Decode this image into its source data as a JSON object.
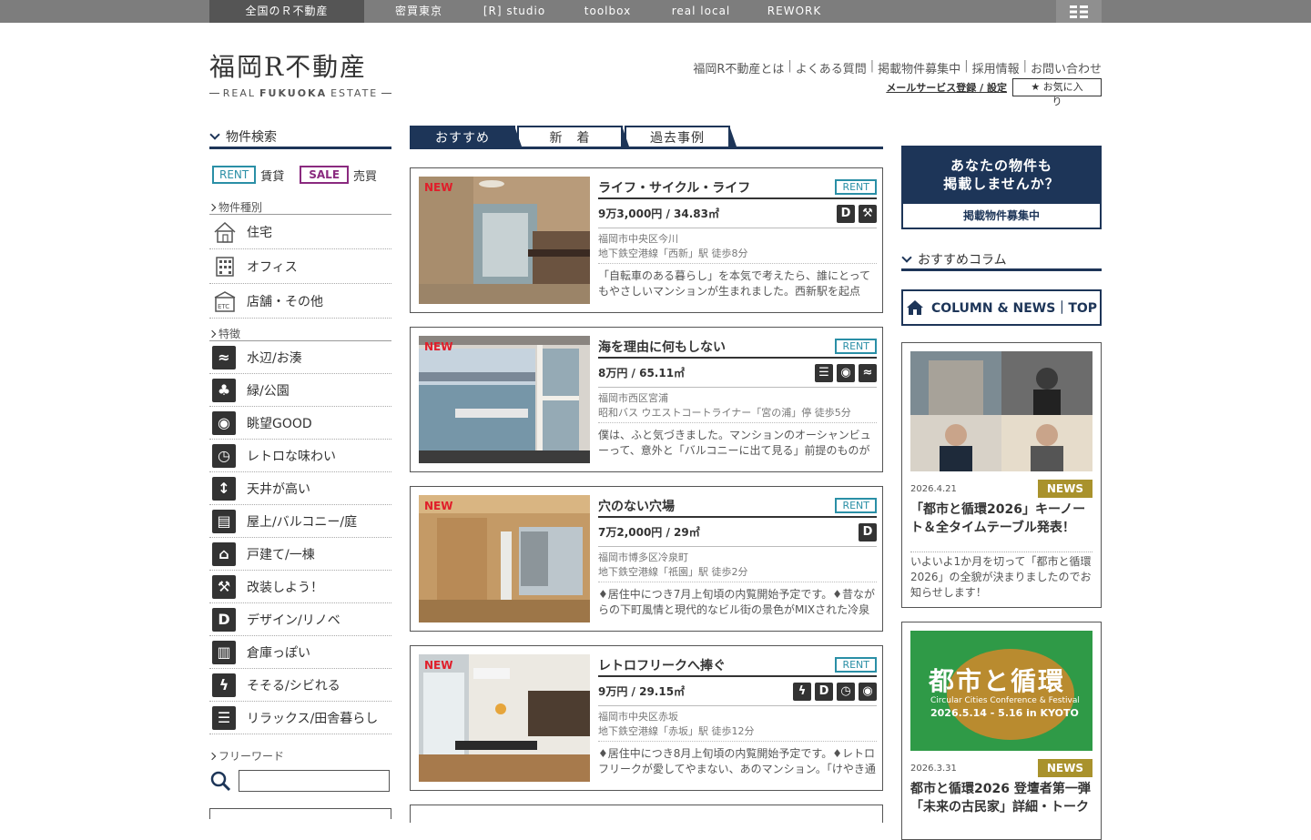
{
  "topnav": {
    "items": [
      "全国のＲ不動産",
      "密買東京",
      "[R] studio",
      "toolbox",
      "real local",
      "REWORK"
    ]
  },
  "header": {
    "logo_jp": "福岡R不動産",
    "logo_en_a": "REAL",
    "logo_en_b": "FUKUOKA",
    "logo_en_c": "ESTATE",
    "links": [
      "福岡R不動産とは",
      "よくある質問",
      "掲載物件募集中",
      "採用情報",
      "お問い合わせ"
    ],
    "mail_service": "メールサービス登録 / 設定",
    "favorites": "★ お気に入り"
  },
  "sidebar": {
    "search_title": "物件検索",
    "rent_badge": "RENT",
    "rent_label": "賃貸",
    "sale_badge": "SALE",
    "sale_label": "売買",
    "type_heading": "物件種別",
    "types": [
      "住宅",
      "オフィス",
      "店舗・その他"
    ],
    "feature_heading": "特徴",
    "features": [
      "水辺/お湊",
      "緑/公園",
      "眺望GOOD",
      "レトロな味わい",
      "天井が高い",
      "屋上/バルコニー/庭",
      "戸建て/一棟",
      "改装しよう！",
      "デザイン/リノベ",
      "倉庫っぽい",
      "そそる/シビれる",
      "リラックス/田舎暮らし"
    ],
    "keyword_heading": "フリーワード",
    "keyword_value": ""
  },
  "tabs": [
    "おすすめ",
    "新　着",
    "過去事例"
  ],
  "listings": [
    {
      "new": "NEW",
      "title": "ライフ・サイクル・ライフ",
      "badge": "RENT",
      "price": "9万3,000円 / 34.83㎡",
      "icons": [
        "D",
        "tool"
      ],
      "addr1": "福岡市中央区今川",
      "addr2": "地下鉄空港線「西新」駅 徒歩8分",
      "desc": "「自転車のある暮らし」を本気で考えたら、誰にとってもやさしいマンションが生まれました。西新駅を起点"
    },
    {
      "new": "NEW",
      "title": "海を理由に何もしない",
      "badge": "RENT",
      "price": "8万円 / 65.11㎡",
      "icons": [
        "wave",
        "eye",
        "shore"
      ],
      "addr1": "福岡市西区宮浦",
      "addr2": "昭和バス ウエストコートライナー「宮の浦」停 徒歩5分",
      "desc": "僕は、ふと気づきました。マンションのオーシャンビューって、意外と「バルコニーに出て見る」前提のものが"
    },
    {
      "new": "NEW",
      "title": "穴のない穴場",
      "badge": "RENT",
      "price": "7万2,000円 / 29㎡",
      "icons": [
        "D"
      ],
      "addr1": "福岡市博多区冷泉町",
      "addr2": "地下鉄空港線「祇園」駅 徒歩2分",
      "desc": "♦居住中につき7月上旬頃の内覧開始予定です。♦昔ながらの下町風情と現代的なビル街の景色がMIXされた冷泉"
    },
    {
      "new": "NEW",
      "title": "レトロフリークへ捧ぐ",
      "badge": "RENT",
      "price": "9万円 / 29.15㎡",
      "icons": [
        "bolt",
        "D",
        "retro",
        "eye"
      ],
      "addr1": "福岡市中央区赤坂",
      "addr2": "地下鉄空港線「赤坂」駅 徒歩12分",
      "desc": "♦居住中につき8月上旬頃の内覧開始予定です。♦レトロフリークが愛してやまない、あのマンション。「けやき通"
    }
  ],
  "right": {
    "promo_line1": "あなたの物件も",
    "promo_line2": "掲載しませんか？",
    "promo_button": "掲載物件募集中",
    "column_title": "おすすめコラム",
    "column_button": "COLUMN & NEWS｜TOP",
    "news": [
      {
        "date": "2026.4.21",
        "tag": "NEWS",
        "title": "「都市と循環2026」キーノート＆全タイムテーブル発表！",
        "body": "いよいよ1か月を切って「都市と循環2026」の全貌が決まりましたのでお知らせします！"
      },
      {
        "date": "2026.3.31",
        "tag": "NEWS",
        "title": "都市と循環2026 登壇者第一弾「未来の古民家」詳細・トーク",
        "poster_title": "都市と循環",
        "poster_sub": "Circular Cities Conference & Festival",
        "poster_date": "2026.5.14 - 5.16 in KYOTO"
      }
    ]
  },
  "colors": {
    "navy": "#1d3558",
    "rent": "#2a8fa6",
    "sale": "#8a2a7f",
    "new": "#e01e2a",
    "news_tag": "#a9922c"
  }
}
